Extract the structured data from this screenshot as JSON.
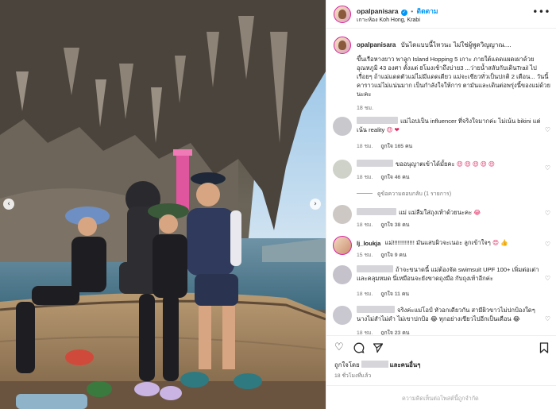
{
  "header": {
    "username": "opalpanisara",
    "follow_label": "ติดตาม",
    "location": "เกาะห้อง Koh Hong, Krabi",
    "more_icon": "more-icon"
  },
  "caption": {
    "username": "opalpanisara",
    "first_line": "บันไดแบบนี้ไหวนะ ไม่ใช่ผู้พูดวิญญาณ....",
    "body": "ขึ้นเรือหางยาว พาลูก Island Hopping 5 เกาะ ภายใต้แดดแผดเผาด้วยอุณหภูมิ 43 องศา ตั้งแต่ 8โมงเช้าถึงบ่าย3 ...ว่ายน้ำสลับกับเดินTrail ไปเรื่อยๆ ถ้าแม่แดดตัวแม่ไม่มีแดดเดียว แม่จะเขียวทั่วเป็นปกติ 2 เดือน... วันนี้คาราวแม่ไม่แน่นมาก เป็นกำลังใจให้การ ตามันและเดินต่อพรุ่งนี้ของแม่ด้วยนะคะ",
    "time": "18 ชม."
  },
  "comments": [
    {
      "text": "แม่ไอปเป็น influencer ที่จริงใจมากค่ะ ไม่เน้น bikini แต่เน้น reality",
      "emoji": "😍 ❤",
      "time": "18 ชม.",
      "likes": "ถูกใจ 165 คน",
      "reply": "ตอบกลับ"
    },
    {
      "text": "ขออนุญาตเข้าได้มั้ยคะ",
      "emoji": "😍 😍 😍 😍 😍",
      "time": "18 ชม.",
      "likes": "ถูกใจ 46 คน",
      "reply": "ตอบกลับ"
    },
    {
      "text": "แม่ แม่ลืมใส่ถุงเท้าด้วยนะคะ",
      "emoji": "😂",
      "time": "18 ชม.",
      "likes": "ถูกใจ 38 คน",
      "reply": "ตอบกลับ"
    },
    {
      "username": "lj_loukja",
      "text": "แม่!!!!!!!!!!!!! มันแสบผิวจะเนอะ ลูกเข้าใจๆ",
      "emoji": "😍 👍",
      "time": "15 ชม.",
      "likes": "ถูกใจ 9 คน",
      "reply": "ตอบกลับ"
    },
    {
      "text": "ถ้าจะขนาดนี้ แม่ต้องจัด swimsuit UPF 100+ เพิ่มต่อเต่าและคลุมหมด นี่เหมือนจะยังขาดถุงมือ กับถุงเท้าอีกค่ะ",
      "emoji": "",
      "time": "18 ชม.",
      "likes": "ถูกใจ 11 คน",
      "reply": "ตอบกลับ"
    },
    {
      "text": "จริงค่ะแม่โอป์ หัวอกเดียวกัน สามีผิวขาวไม่ปกป้องใดๆนางไม่สำไม่ดำ ไม่เขาปกป้อ",
      "emoji": "😂 ทุกอย่างเขียวไปอีกเป็นเดือน 😂",
      "time": "18 ชม.",
      "likes": "ถูกใจ 23 คน",
      "reply": "ตอบกลับ"
    }
  ],
  "view_replies_label": "ดูข้อความตอบกลับ (1 รายการ)",
  "actions": {
    "like_icon": "heart-icon",
    "comment_icon": "comment-icon",
    "share_icon": "share-icon",
    "save_icon": "bookmark-icon"
  },
  "liked_by": {
    "prefix": "ถูกใจโดย",
    "suffix": "และคนอื่นๆ"
  },
  "post_time": "18 ชั่วโมงที่แล้ว",
  "comment_box": {
    "placeholder": "ความคิดเห็นต่อโพสต์นี้ถูกจำกัด"
  },
  "carousel": {
    "prev_icon": "chevron-left-icon",
    "next_icon": "chevron-right-icon"
  },
  "colors": {
    "accent": "#0095f6",
    "text": "#262626",
    "muted": "#737373",
    "redaction": "#d6d6da"
  }
}
